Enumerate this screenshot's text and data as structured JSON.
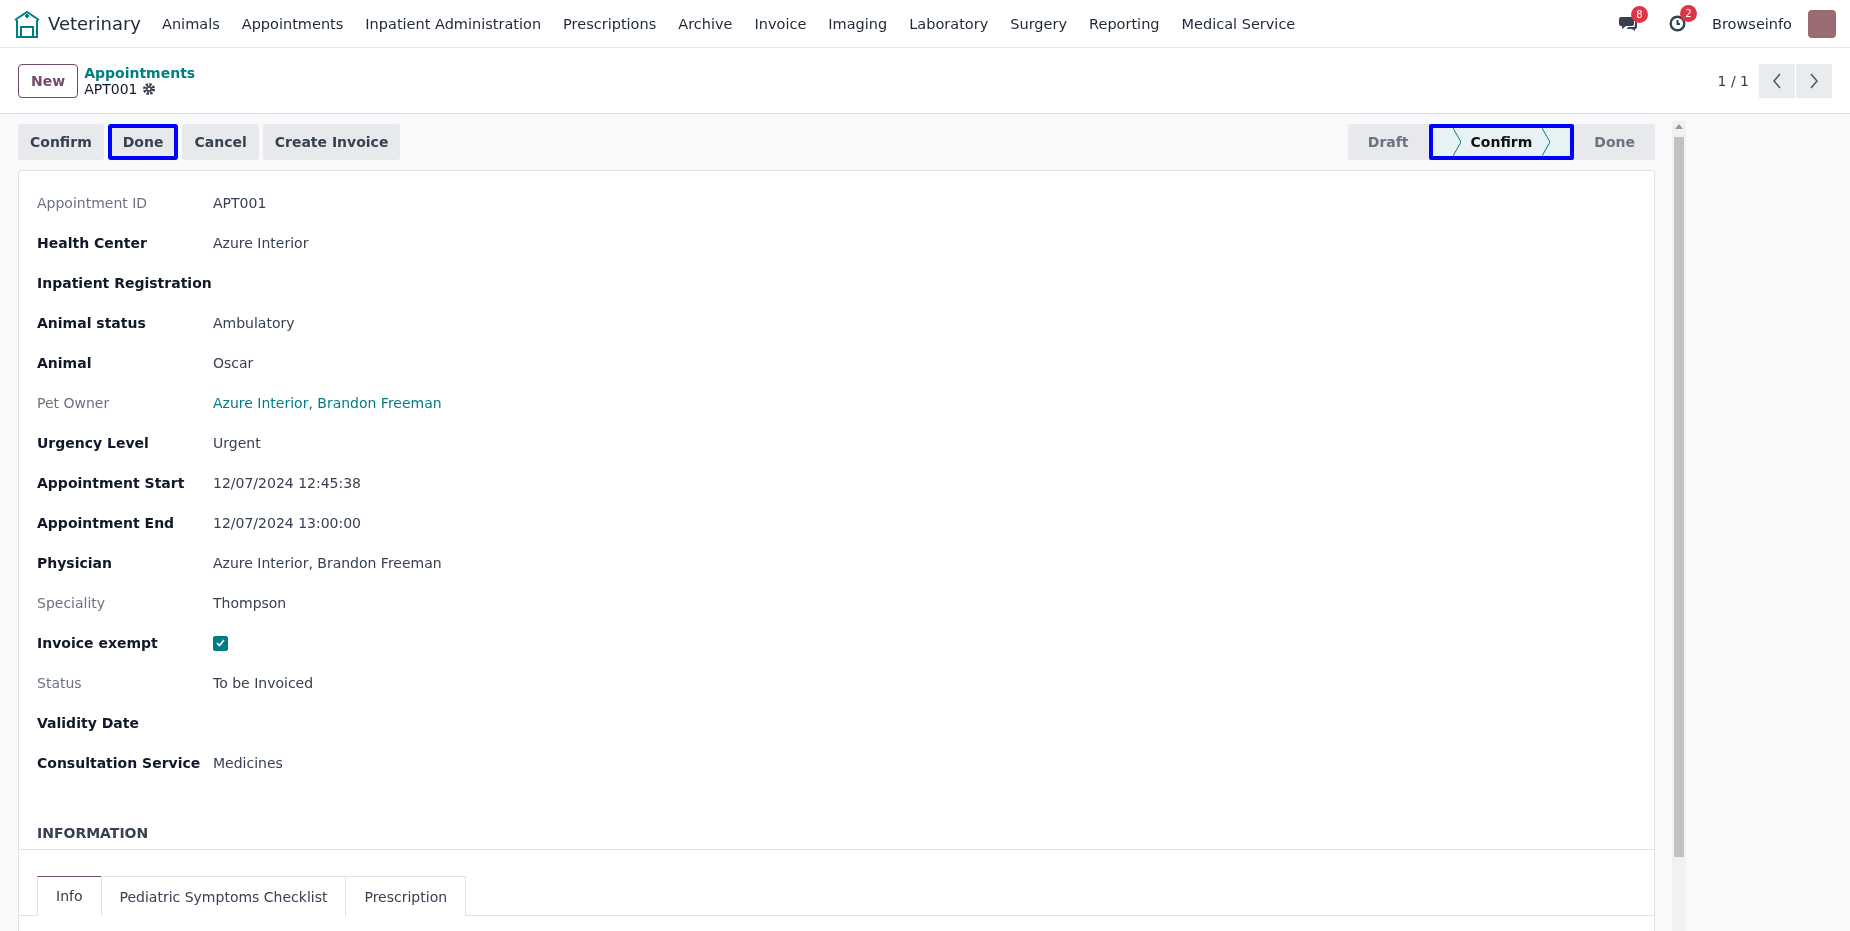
{
  "navbar": {
    "app_name": "Veterinary",
    "menu": [
      "Animals",
      "Appointments",
      "Inpatient Administration",
      "Prescriptions",
      "Archive",
      "Invoice",
      "Imaging",
      "Laboratory",
      "Surgery",
      "Reporting",
      "Medical Service"
    ],
    "messages_count": "8",
    "activities_count": "2",
    "company": "Browseinfo"
  },
  "control_panel": {
    "new_button": "New",
    "breadcrumb": "Appointments",
    "record_name": "APT001",
    "pager": "1 / 1"
  },
  "action_buttons": [
    {
      "label": "Confirm",
      "highlighted": false
    },
    {
      "label": "Done",
      "highlighted": true
    },
    {
      "label": "Cancel",
      "highlighted": false
    },
    {
      "label": "Create Invoice",
      "highlighted": false
    }
  ],
  "status_bar": [
    {
      "label": "Draft",
      "selected": false,
      "highlighted": false
    },
    {
      "label": "Confirm",
      "selected": true,
      "highlighted": true
    },
    {
      "label": "Done",
      "selected": false,
      "highlighted": false
    }
  ],
  "fields": [
    {
      "label": "Appointment ID",
      "label_bold": false,
      "kind": "text",
      "value": "APT001"
    },
    {
      "label": "Health Center",
      "label_bold": true,
      "kind": "text",
      "value": "Azure Interior"
    },
    {
      "label": "Inpatient Registration",
      "label_bold": true,
      "kind": "text"
    },
    {
      "label": "Animal status",
      "label_bold": true,
      "kind": "text",
      "value": "Ambulatory"
    },
    {
      "label": "Animal",
      "label_bold": true,
      "kind": "text",
      "value": "Oscar"
    },
    {
      "label": "Pet Owner",
      "label_bold": false,
      "kind": "link",
      "value": "Azure Interior, Brandon Freeman"
    },
    {
      "label": "Urgency Level",
      "label_bold": true,
      "kind": "text",
      "value": "Urgent"
    },
    {
      "label": "Appointment Start",
      "label_bold": true,
      "kind": "text",
      "value": "12/07/2024 12:45:38"
    },
    {
      "label": "Appointment End",
      "label_bold": true,
      "kind": "text",
      "value": "12/07/2024 13:00:00"
    },
    {
      "label": "Physician",
      "label_bold": true,
      "kind": "text",
      "value": "Azure Interior, Brandon Freeman"
    },
    {
      "label": "Speciality",
      "label_bold": false,
      "kind": "text",
      "value": "Thompson"
    },
    {
      "label": "Invoice exempt",
      "label_bold": true,
      "kind": "checkbox",
      "checked": true
    },
    {
      "label": "Status",
      "label_bold": false,
      "kind": "text",
      "value": "To be Invoiced"
    },
    {
      "label": "Validity Date",
      "label_bold": true,
      "kind": "text"
    },
    {
      "label": "Consultation Service",
      "label_bold": true,
      "kind": "text",
      "value": "Medicines"
    }
  ],
  "section_title": "INFORMATION",
  "tabs": [
    {
      "label": "Info",
      "selected": true
    },
    {
      "label": "Pediatric Symptoms Checklist",
      "selected": false
    },
    {
      "label": "Prescription",
      "selected": false
    }
  ]
}
